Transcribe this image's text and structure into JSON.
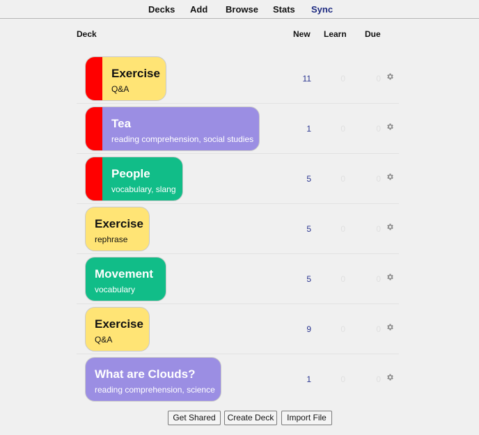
{
  "nav": {
    "decks": "Decks",
    "add": "Add",
    "browse": "Browse",
    "stats": "Stats",
    "sync": "Sync"
  },
  "columns": {
    "deck": "Deck",
    "new": "New",
    "learn": "Learn",
    "due": "Due"
  },
  "decks": [
    {
      "title": "Exercise",
      "subtitle": "Q&A",
      "color": "#ffe475",
      "flag": true,
      "new": "11",
      "learn": "0",
      "due": "0"
    },
    {
      "title": "Tea",
      "subtitle": "reading comprehension, social studies",
      "color": "#9b8ee3",
      "flag": true,
      "new": "1",
      "learn": "0",
      "due": "0"
    },
    {
      "title": "People",
      "subtitle": "vocabulary, slang",
      "color": "#11bd88",
      "flag": true,
      "new": "5",
      "learn": "0",
      "due": "0"
    },
    {
      "title": "Exercise",
      "subtitle": "rephrase",
      "color": "#ffe475",
      "flag": false,
      "new": "5",
      "learn": "0",
      "due": "0"
    },
    {
      "title": "Movement",
      "subtitle": "vocabulary",
      "color": "#11bd88",
      "flag": false,
      "new": "5",
      "learn": "0",
      "due": "0"
    },
    {
      "title": "Exercise",
      "subtitle": "Q&A",
      "color": "#ffe475",
      "flag": false,
      "new": "9",
      "learn": "0",
      "due": "0"
    },
    {
      "title": "What are Clouds?",
      "subtitle": "reading comprehension, science",
      "color": "#9b8ee3",
      "flag": false,
      "new": "1",
      "learn": "0",
      "due": "0"
    }
  ],
  "buttons": {
    "get_shared": "Get Shared",
    "create_deck": "Create Deck",
    "import_file": "Import File"
  },
  "colors": {
    "flag": "#ff0000",
    "new_count": "#2a3590",
    "sync_link": "#1d2a80"
  }
}
